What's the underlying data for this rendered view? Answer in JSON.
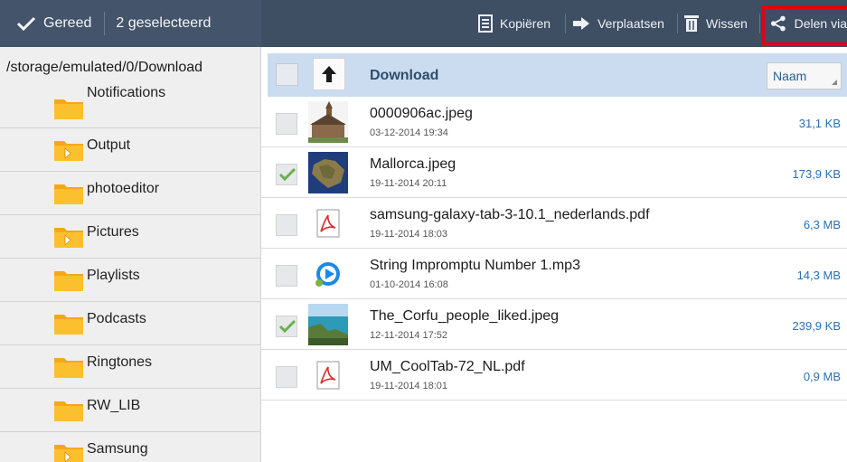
{
  "actionbar": {
    "done_label": "Gereed",
    "selected_label": "2 geselecteerd",
    "copy_label": "Kopiëren",
    "move_label": "Verplaatsen",
    "delete_label": "Wissen",
    "share_label": "Delen via"
  },
  "path_panel": {
    "path": "/storage/emulated/0/Download",
    "folders": [
      {
        "name": "Notifications",
        "icon": "folder-icon"
      },
      {
        "name": "Output",
        "icon": "folder-arrow-icon"
      },
      {
        "name": "photoeditor",
        "icon": "folder-icon"
      },
      {
        "name": "Pictures",
        "icon": "folder-arrow-icon"
      },
      {
        "name": "Playlists",
        "icon": "folder-icon"
      },
      {
        "name": "Podcasts",
        "icon": "folder-icon"
      },
      {
        "name": "Ringtones",
        "icon": "folder-icon"
      },
      {
        "name": "RW_LIB",
        "icon": "folder-icon"
      },
      {
        "name": "Samsung",
        "icon": "folder-arrow-icon"
      }
    ]
  },
  "list": {
    "header_title": "Download",
    "sort_value": "Naam",
    "files": [
      {
        "name": "0000906ac.jpeg",
        "date": "03-12-2014 19:34",
        "size": "31,1 KB",
        "checked": false,
        "thumb": "church-photo"
      },
      {
        "name": "Mallorca.jpeg",
        "date": "19-11-2014 20:11",
        "size": "173,9 KB",
        "checked": true,
        "thumb": "island-photo"
      },
      {
        "name": "samsung-galaxy-tab-3-10.1_nederlands.pdf",
        "date": "19-11-2014 18:03",
        "size": "6,3 MB",
        "checked": false,
        "thumb": "pdf-icon"
      },
      {
        "name": "String Impromptu Number 1.mp3",
        "date": "01-10-2014 16:08",
        "size": "14,3 MB",
        "checked": false,
        "thumb": "audio-icon"
      },
      {
        "name": "The_Corfu_people_liked.jpeg",
        "date": "12-11-2014 17:52",
        "size": "239,9 KB",
        "checked": true,
        "thumb": "coast-photo"
      },
      {
        "name": "UM_CoolTab-72_NL.pdf",
        "date": "19-11-2014 18:01",
        "size": "0,9 MB",
        "checked": false,
        "thumb": "pdf-icon"
      }
    ]
  },
  "colors": {
    "actionbar": "#3e4e63",
    "highlight": "#e60012",
    "header": "#cbdcf0",
    "size_text": "#2a6fb5",
    "check_green": "#6ab04c"
  }
}
